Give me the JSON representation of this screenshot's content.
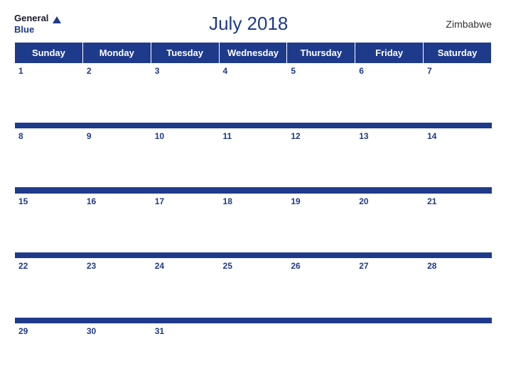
{
  "header": {
    "logo_general": "General",
    "logo_blue": "Blue",
    "title": "July 2018",
    "country": "Zimbabwe"
  },
  "days_of_week": [
    "Sunday",
    "Monday",
    "Tuesday",
    "Wednesday",
    "Thursday",
    "Friday",
    "Saturday"
  ],
  "weeks": [
    [
      1,
      2,
      3,
      4,
      5,
      6,
      7
    ],
    [
      8,
      9,
      10,
      11,
      12,
      13,
      14
    ],
    [
      15,
      16,
      17,
      18,
      19,
      20,
      21
    ],
    [
      22,
      23,
      24,
      25,
      26,
      27,
      28
    ],
    [
      29,
      30,
      31,
      null,
      null,
      null,
      null
    ]
  ]
}
